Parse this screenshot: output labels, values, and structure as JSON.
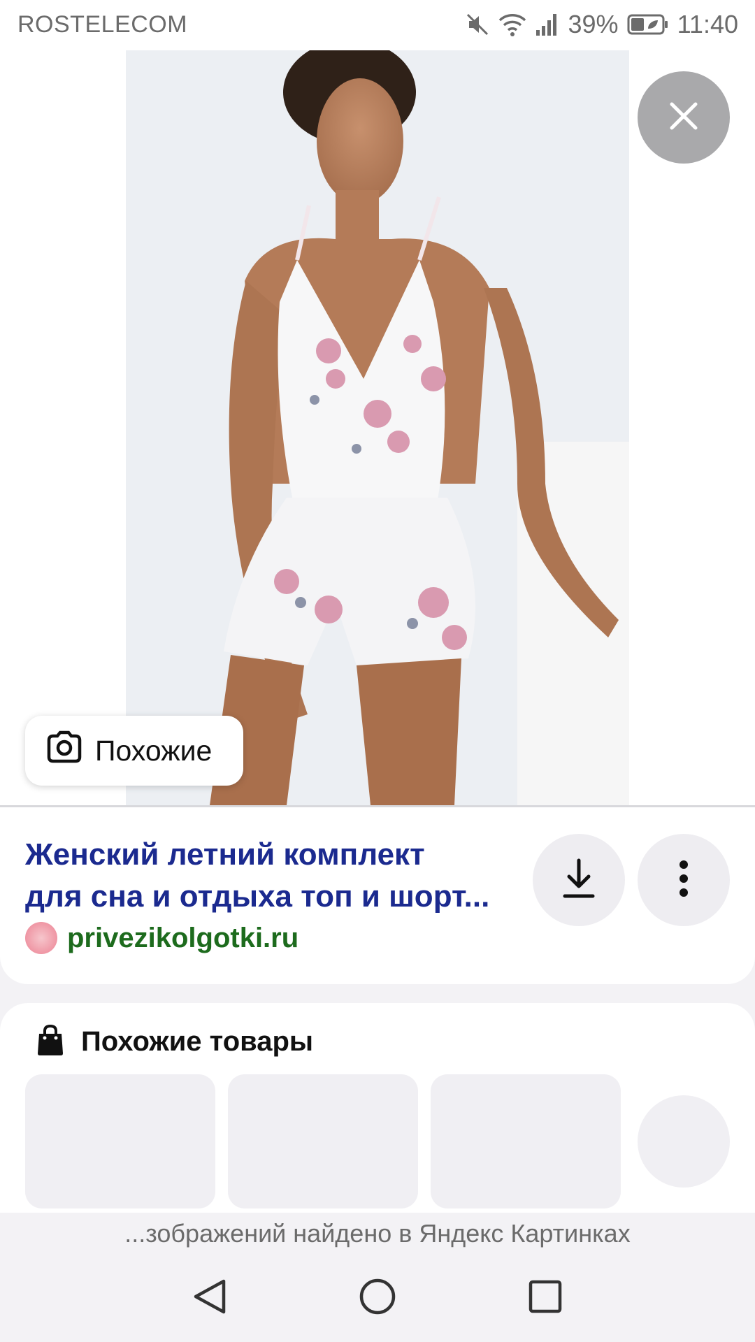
{
  "status_bar": {
    "carrier": "ROSTELECOM",
    "battery": "39%",
    "time": "11:40",
    "icons": [
      "mute-icon",
      "wifi-icon",
      "signal-icon",
      "battery-icon"
    ]
  },
  "viewer": {
    "similar_label": "Похожие"
  },
  "result": {
    "title_line1": "Женский летний комплект",
    "title_line2": "для сна и отдыха топ и шорт...",
    "source": "privezikolgotki.ru"
  },
  "products": {
    "title": "Похожие товары"
  },
  "footer": {
    "text": "...зображений найдено в Яндекс Картинках"
  },
  "colors": {
    "title": "#1b2a8f",
    "source": "#1d6b1d",
    "close_bg": "#a9a9ab"
  }
}
